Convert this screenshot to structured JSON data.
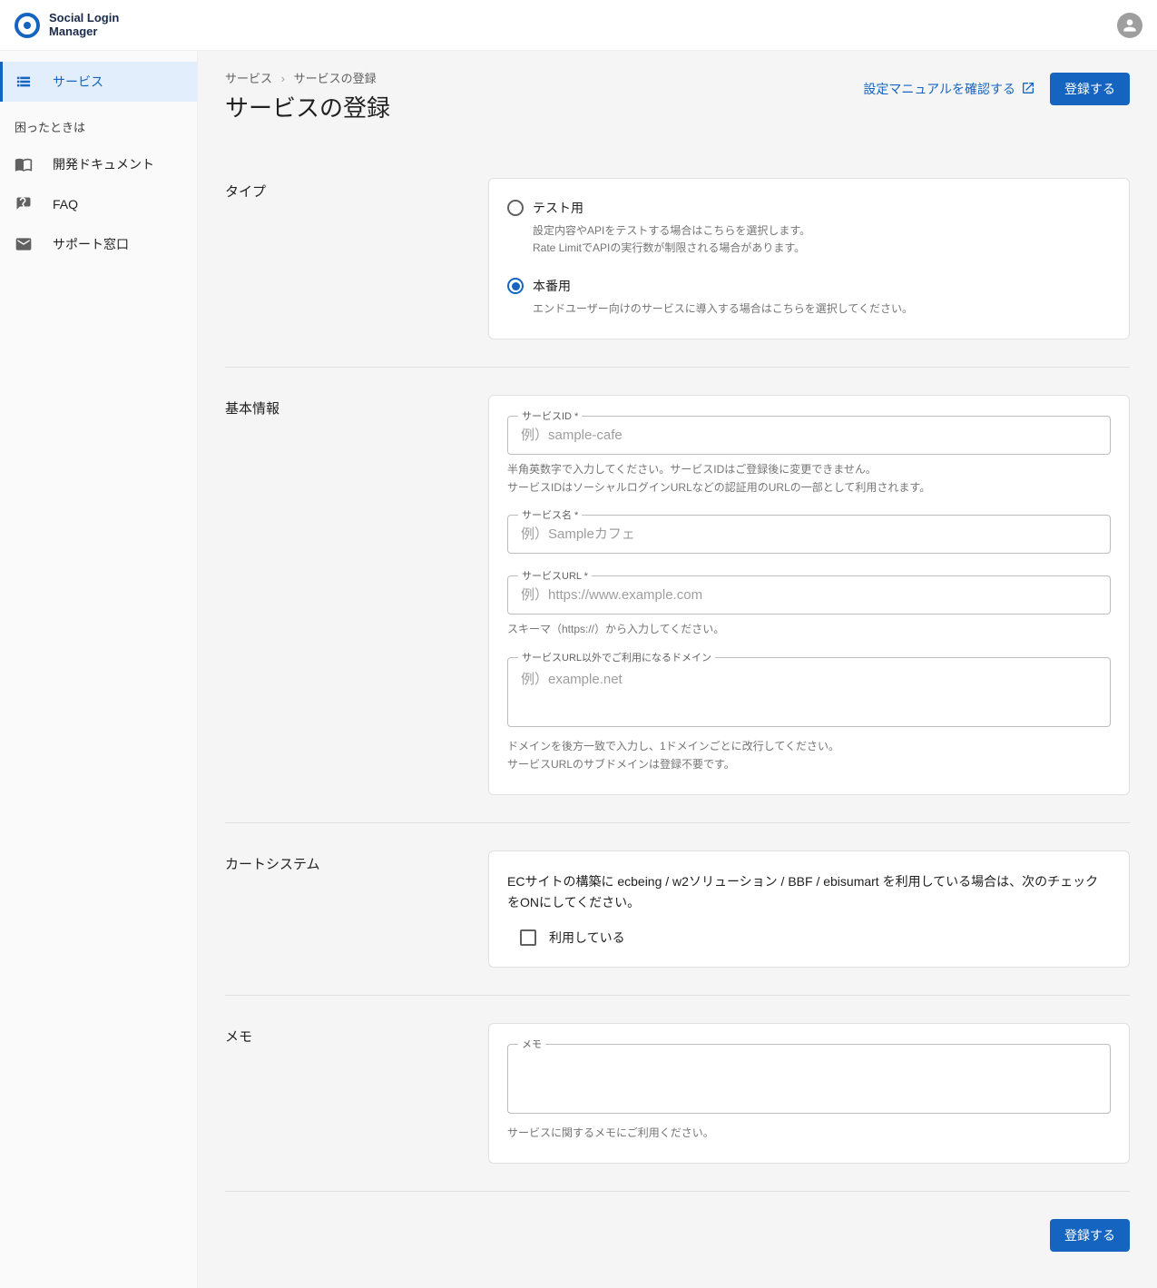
{
  "app": {
    "name_line1": "Social Login",
    "name_line2": "Manager"
  },
  "sidebar": {
    "items": [
      {
        "label": "サービス"
      }
    ],
    "help_heading": "困ったときは",
    "help_items": [
      {
        "label": "開発ドキュメント"
      },
      {
        "label": "FAQ"
      },
      {
        "label": "サポート窓口"
      }
    ]
  },
  "breadcrumb": {
    "parent": "サービス",
    "current": "サービスの登録"
  },
  "page_title": "サービスの登録",
  "actions": {
    "manual_link": "設定マニュアルを確認する",
    "register": "登録する"
  },
  "type_section": {
    "heading": "タイプ",
    "options": [
      {
        "label": "テスト用",
        "checked": false,
        "help1": "設定内容やAPIをテストする場合はこちらを選択します。",
        "help2": "Rate LimitでAPIの実行数が制限される場合があります。"
      },
      {
        "label": "本番用",
        "checked": true,
        "help1": "エンドユーザー向けのサービスに導入する場合はこちらを選択してください。"
      }
    ]
  },
  "basic_section": {
    "heading": "基本情報",
    "service_id": {
      "label": "サービスID *",
      "placeholder": "例）sample-cafe",
      "hint1": "半角英数字で入力してください。サービスIDはご登録後に変更できません。",
      "hint2": "サービスIDはソーシャルログインURLなどの認証用のURLの一部として利用されます。"
    },
    "service_name": {
      "label": "サービス名 *",
      "placeholder": "例）Sampleカフェ"
    },
    "service_url": {
      "label": "サービスURL *",
      "placeholder": "例）https://www.example.com",
      "hint": "スキーマ（https://）から入力してください。"
    },
    "extra_domain": {
      "label": "サービスURL以外でご利用になるドメイン",
      "placeholder": "例）example.net",
      "hint1": "ドメインを後方一致で入力し、1ドメインごとに改行してください。",
      "hint2": "サービスURLのサブドメインは登録不要です。"
    }
  },
  "cart_section": {
    "heading": "カートシステム",
    "desc": "ECサイトの構築に ecbeing / w2ソリューション / BBF / ebisumart を利用している場合は、次のチェックをONにしてください。",
    "checkbox_label": "利用している"
  },
  "memo_section": {
    "heading": "メモ",
    "label": "メモ",
    "hint": "サービスに関するメモにご利用ください。"
  }
}
